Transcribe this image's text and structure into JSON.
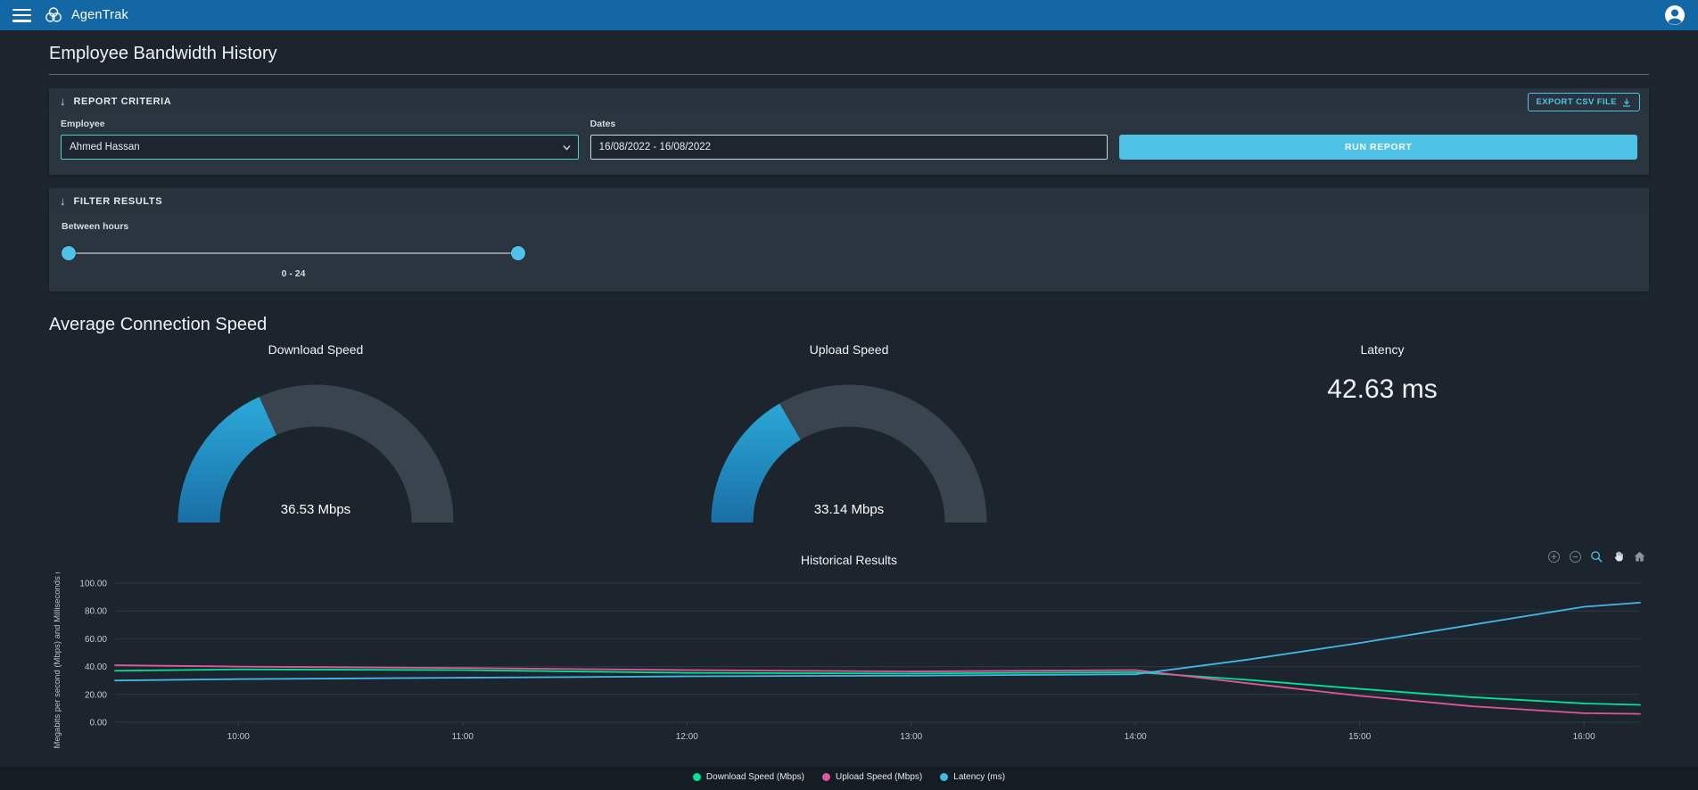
{
  "app_bar": {
    "title": "AgenTrak"
  },
  "icons": {
    "collapse_arrow": "↓"
  },
  "page": {
    "title": "Employee Bandwidth History"
  },
  "report_criteria": {
    "title": "REPORT CRITERIA",
    "export_button": "EXPORT CSV FILE",
    "employee": {
      "label": "Employee",
      "value": "Ahmed Hassan"
    },
    "dates": {
      "label": "Dates",
      "value": "16/08/2022 - 16/08/2022"
    },
    "run_button": "RUN REPORT"
  },
  "filter_results": {
    "title": "FILTER RESULTS",
    "between_hours_label": "Between hours",
    "range_display": "0 - 24",
    "range_min": 0,
    "range_max": 24
  },
  "average_section": {
    "title": "Average Connection Speed"
  },
  "gauges": [
    {
      "title": "Download Speed",
      "value": 36.53,
      "max": 100,
      "display": "36.53 Mbps"
    },
    {
      "title": "Upload Speed",
      "value": 33.14,
      "max": 100,
      "display": "33.14 Mbps"
    }
  ],
  "latency": {
    "title": "Latency",
    "display": "42.63 ms"
  },
  "colors": {
    "accent": "#4FC3E7",
    "appbar": "#1467A5",
    "gauge_track": "#3A444E",
    "gauge_fill_start": "#2AA6D6",
    "gauge_fill_end": "#1A6FA6",
    "grid": "#2E3942",
    "tick_text": "#C3CAD1"
  },
  "chart_data": {
    "type": "line",
    "title": "Historical Results",
    "ylabel": "Megabits per second (Mbps) and Milliseconds (ms)",
    "ylim": [
      0,
      100
    ],
    "ytick_labels": [
      "0.00",
      "20.00",
      "40.00",
      "60.00",
      "80.00",
      "100.00"
    ],
    "xlim": [
      9.45,
      16.25
    ],
    "xtick_hours": [
      10,
      11,
      12,
      13,
      14,
      15,
      16
    ],
    "xtick_labels": [
      "10:00",
      "11:00",
      "12:00",
      "13:00",
      "14:00",
      "15:00",
      "16:00"
    ],
    "x_hours": [
      9.45,
      10,
      11,
      12,
      13,
      14,
      14.5,
      15,
      15.5,
      16,
      16.25
    ],
    "series": [
      {
        "name": "Download Speed (Mbps)",
        "color": "#00E396",
        "values": [
          37,
          38,
          37.5,
          35.5,
          35,
          36,
          30.5,
          24,
          18,
          13.5,
          12.5
        ]
      },
      {
        "name": "Upload Speed (Mbps)",
        "color": "#E0569E",
        "values": [
          41,
          40,
          39,
          37.5,
          36.5,
          37.5,
          28,
          19,
          11.5,
          6.5,
          6
        ]
      },
      {
        "name": "Latency (ms)",
        "color": "#45B6E8",
        "values": [
          30,
          31,
          32,
          33,
          33.5,
          34.5,
          45,
          57,
          70,
          83,
          86
        ]
      }
    ],
    "legend_position": "bottom",
    "grid": true
  }
}
